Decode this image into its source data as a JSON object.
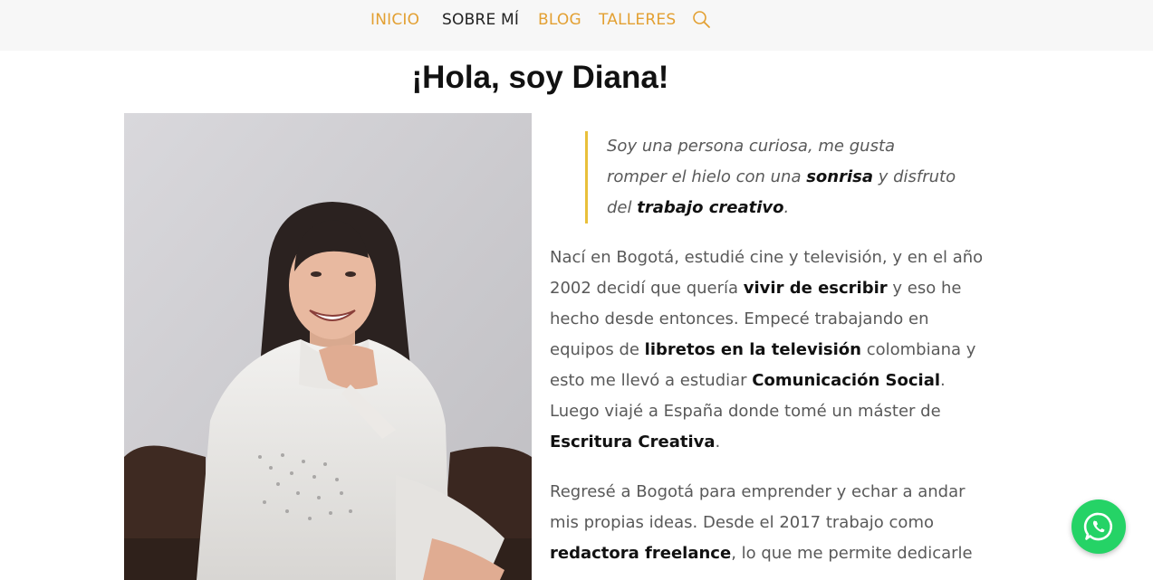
{
  "nav": {
    "items": [
      {
        "label": "INICIO",
        "active": false
      },
      {
        "label": "SOBRE MÍ",
        "active": true
      },
      {
        "label": "BLOG",
        "active": false
      },
      {
        "label": "TALLERES",
        "active": false
      }
    ],
    "search_icon": "search-icon"
  },
  "page": {
    "title": "¡Hola, soy Diana!"
  },
  "quote": {
    "l1": "Soy una persona curiosa, me gusta",
    "l2a": "romper el hielo con una ",
    "l2b": "sonrisa",
    "l2c": " y disfruto",
    "l3a": "del ",
    "l3b": "trabajo creativo",
    "l3c": "."
  },
  "para1": {
    "l1": "Nací en Bogotá, estudié cine y televisión, y en el año",
    "l2a": "2002 decidí que quería ",
    "l2b": "vivir de escribir",
    "l2c": " y eso he",
    "l3": "hecho desde entonces. Empecé trabajando en",
    "l4a": "equipos de ",
    "l4b": "libretos en la televisión",
    "l4c": " colombiana y",
    "l5a": "esto me llevó a estudiar ",
    "l5b": "Comunicación Social",
    "l5c": ".",
    "l6": "Luego viajé a España donde tomé un máster de",
    "l7a": "Escritura Creativa",
    "l7b": "."
  },
  "para2": {
    "l1": "Regresé a Bogotá para emprender y echar a andar",
    "l2": "mis propias ideas. Desde el 2017 trabajo como",
    "l3a": "redactora freelance",
    "l3b": ", lo que me permite dedicarle"
  },
  "colors": {
    "nav_link": "#e3a032",
    "nav_active": "#222222",
    "quote_border": "#e9c03a",
    "whatsapp": "#25d366"
  },
  "whatsapp_icon": "whatsapp-icon"
}
